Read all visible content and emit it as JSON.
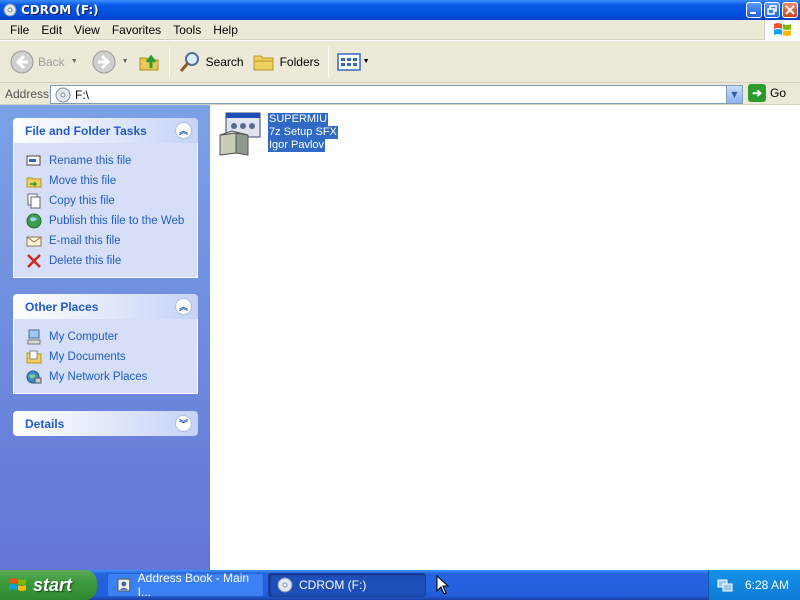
{
  "window": {
    "title": "CDROM (F:)",
    "buttons": {
      "minimize": "minimize-icon",
      "maximize": "maximize-icon",
      "close": "close-icon"
    }
  },
  "menu": {
    "items": [
      "File",
      "Edit",
      "View",
      "Favorites",
      "Tools",
      "Help"
    ]
  },
  "toolbar": {
    "back_label": "Back",
    "search_label": "Search",
    "folders_label": "Folders"
  },
  "address": {
    "label": "Address",
    "value": "F:\\",
    "go_label": "Go"
  },
  "taskpane": {
    "file_tasks": {
      "title": "File and Folder Tasks",
      "items": [
        {
          "label": "Rename this file",
          "icon": "rename-icon"
        },
        {
          "label": "Move this file",
          "icon": "move-icon"
        },
        {
          "label": "Copy this file",
          "icon": "copy-icon"
        },
        {
          "label": "Publish this file to the Web",
          "icon": "globe-icon"
        },
        {
          "label": "E-mail this file",
          "icon": "email-icon"
        },
        {
          "label": "Delete this file",
          "icon": "delete-icon"
        }
      ]
    },
    "other_places": {
      "title": "Other Places",
      "items": [
        {
          "label": "My Computer",
          "icon": "computer-icon"
        },
        {
          "label": "My Documents",
          "icon": "documents-icon"
        },
        {
          "label": "My Network Places",
          "icon": "network-icon"
        }
      ]
    },
    "details": {
      "title": "Details"
    }
  },
  "content": {
    "file": {
      "name": "SUPERMIU",
      "type": "7z Setup SFX",
      "company": "Igor Pavlov",
      "selected": true
    }
  },
  "taskbar": {
    "start_label": "start",
    "buttons": [
      {
        "label": "Address Book - Main I...",
        "active": false
      },
      {
        "label": "CDROM (F:)",
        "active": true
      }
    ],
    "clock": "6:28 AM"
  },
  "colors": {
    "titlebar": "#0a5ae6",
    "taskpane": "#6f8fe0",
    "link": "#215dc6",
    "selection": "#316ac5",
    "start_green": "#3c9a3c"
  }
}
